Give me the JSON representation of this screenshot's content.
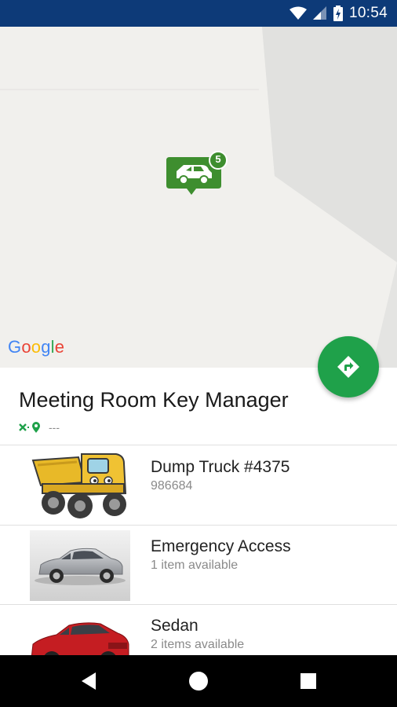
{
  "status_bar": {
    "time": "10:54",
    "background": "#0d3a78"
  },
  "map": {
    "provider_logo": "Google",
    "marker": {
      "icon": "car-icon",
      "badge_count": "5",
      "color": "#3e8e2f"
    }
  },
  "fab": {
    "icon": "directions-icon",
    "color": "#1fa14a"
  },
  "place": {
    "title": "Meeting Room Key Manager",
    "distance": "---"
  },
  "items": [
    {
      "title": "Dump Truck #4375",
      "subtitle": "986684",
      "image": "dump-truck-image"
    },
    {
      "title": "Emergency Access",
      "subtitle": "1 item available",
      "image": "silver-car-image"
    },
    {
      "title": "Sedan",
      "subtitle": "2 items available",
      "image": "red-sedan-image"
    }
  ],
  "nav": {
    "back": "back-icon",
    "home": "home-icon",
    "recents": "recents-icon"
  }
}
